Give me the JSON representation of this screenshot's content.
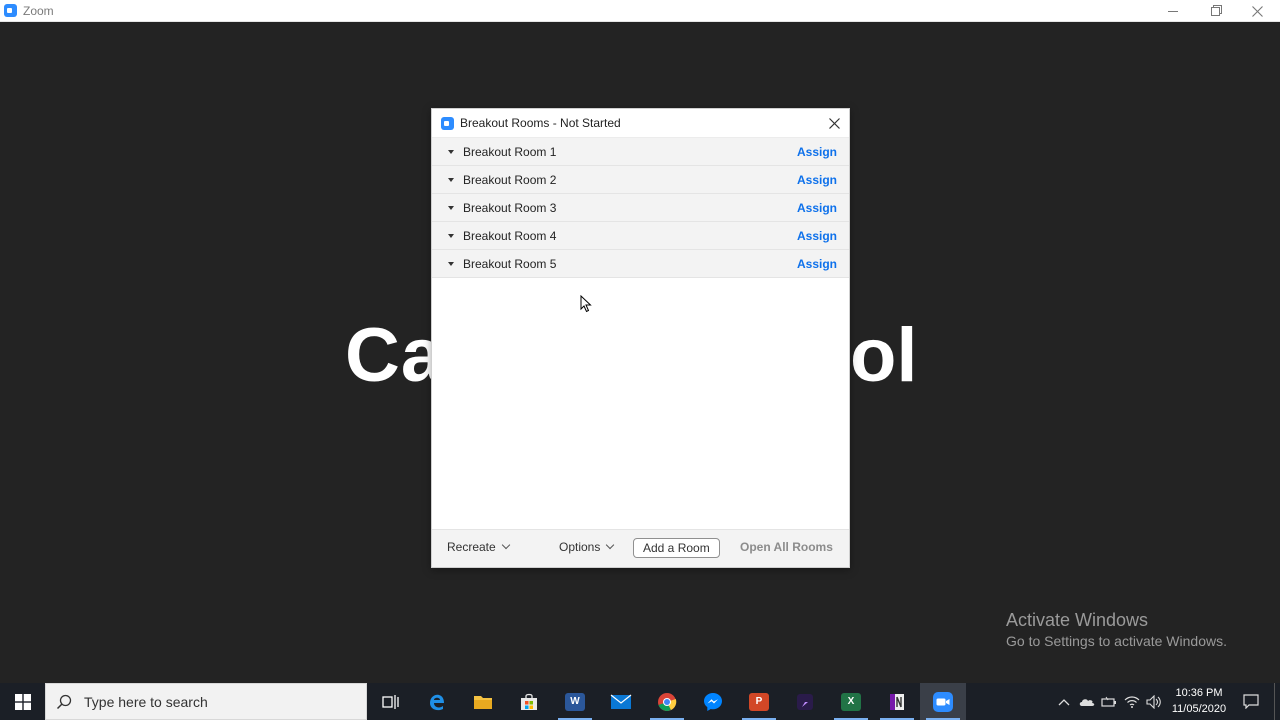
{
  "window": {
    "title": "Zoom"
  },
  "background": {
    "text_left": "Ca",
    "text_right": "ol"
  },
  "dialog": {
    "title": "Breakout Rooms - Not Started",
    "rooms": [
      {
        "name": "Breakout Room 1",
        "action": "Assign"
      },
      {
        "name": "Breakout Room 2",
        "action": "Assign"
      },
      {
        "name": "Breakout Room 3",
        "action": "Assign"
      },
      {
        "name": "Breakout Room 4",
        "action": "Assign"
      },
      {
        "name": "Breakout Room 5",
        "action": "Assign"
      }
    ],
    "footer": {
      "recreate": "Recreate",
      "options": "Options",
      "add_room": "Add a Room",
      "open_all": "Open All Rooms"
    }
  },
  "watermark": {
    "line1": "Activate Windows",
    "line2": "Go to Settings to activate Windows."
  },
  "taskbar": {
    "search_placeholder": "Type here to search",
    "time": "10:36 PM",
    "date": "11/05/2020",
    "apps": [
      {
        "icon": "task-view-icon"
      },
      {
        "icon": "edge-icon"
      },
      {
        "icon": "file-explorer-icon"
      },
      {
        "icon": "store-icon"
      },
      {
        "icon": "word-icon",
        "label": "W"
      },
      {
        "icon": "mail-icon"
      },
      {
        "icon": "chrome-icon"
      },
      {
        "icon": "messenger-icon"
      },
      {
        "icon": "powerpoint-icon",
        "label": "P"
      },
      {
        "icon": "video-editor-icon"
      },
      {
        "icon": "excel-icon",
        "label": "X"
      },
      {
        "icon": "onenote-icon"
      },
      {
        "icon": "zoom-icon"
      }
    ]
  },
  "colors": {
    "accent": "#0e71eb",
    "zoom_blue": "#2d8cff",
    "background": "#232323",
    "taskbar": "#1b1f26"
  }
}
